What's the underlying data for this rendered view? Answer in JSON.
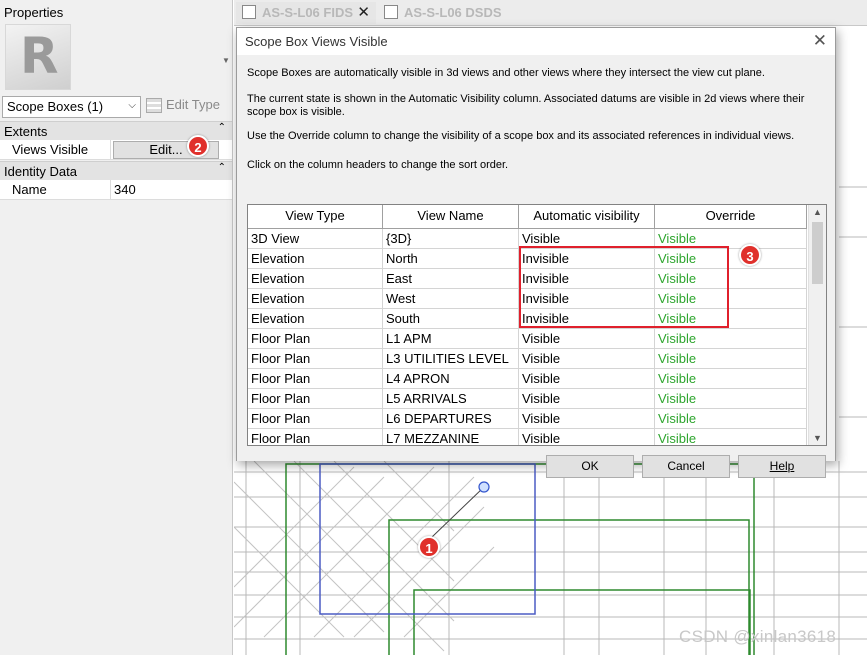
{
  "properties": {
    "title": "Properties",
    "type_selector": "Scope Boxes (1)",
    "edit_type_label": "Edit Type",
    "groups": [
      {
        "name": "Extents",
        "rows": [
          {
            "key": "Views Visible",
            "value": "Edit..."
          }
        ]
      },
      {
        "name": "Identity Data",
        "rows": [
          {
            "key": "Name",
            "value": "340"
          }
        ]
      }
    ]
  },
  "tabs": [
    {
      "label": "AS-S-L06 FIDS",
      "active": true
    },
    {
      "label": "AS-S-L06 DSDS",
      "active": false
    }
  ],
  "dialog": {
    "title": "Scope Box Views Visible",
    "paragraphs": [
      "Scope Boxes are automatically visible in 3d views and other views where they intersect the view cut plane.",
      "The current state is shown in the Automatic Visibility column. Associated datums are visible in 2d views where their scope box is visible.",
      "Use the Override column to change the visibility of a scope box and its associated references in individual views.",
      "Click on the column headers to change the sort order."
    ],
    "columns": [
      "View Type",
      "View Name",
      "Automatic visibility",
      "Override"
    ],
    "rows": [
      [
        "3D View",
        "{3D}",
        "Visible",
        "Visible"
      ],
      [
        "Elevation",
        "North",
        "Invisible",
        "Visible"
      ],
      [
        "Elevation",
        "East",
        "Invisible",
        "Visible"
      ],
      [
        "Elevation",
        "West",
        "Invisible",
        "Visible"
      ],
      [
        "Elevation",
        "South",
        "Invisible",
        "Visible"
      ],
      [
        "Floor Plan",
        "L1 APM",
        "Visible",
        "Visible"
      ],
      [
        "Floor Plan",
        "L3 UTILITIES LEVEL",
        "Visible",
        "Visible"
      ],
      [
        "Floor Plan",
        "L4 APRON",
        "Visible",
        "Visible"
      ],
      [
        "Floor Plan",
        "L5 ARRIVALS",
        "Visible",
        "Visible"
      ],
      [
        "Floor Plan",
        "L6 DEPARTURES",
        "Visible",
        "Visible"
      ],
      [
        "Floor Plan",
        "L7 MEZZANINE",
        "Visible",
        "Visible"
      ]
    ],
    "buttons": {
      "ok": "OK",
      "cancel": "Cancel",
      "help": "Help"
    }
  },
  "badges": [
    "1",
    "2",
    "3"
  ],
  "watermark": "CSDN @xinlan3618",
  "colors": {
    "override_green": "#2ea52e",
    "highlight_red": "#e0202c",
    "badge_red": "#e0302b"
  },
  "icons": [
    "revit-logo-icon",
    "edit-type-icon",
    "view-tab-icon",
    "close-icon",
    "scope-box-handle-icon"
  ]
}
